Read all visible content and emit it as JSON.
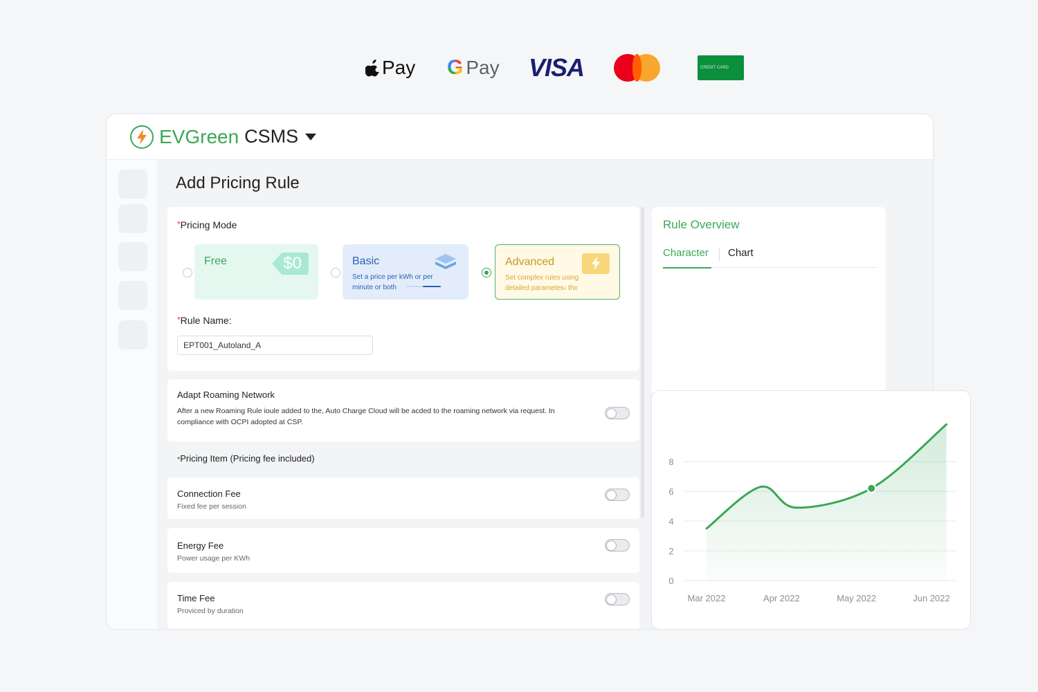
{
  "payment_methods": {
    "apple_pay": "Pay",
    "google_pay": "Pay",
    "visa": "VISA",
    "mastercard_icon": "mastercard-logo",
    "green_card_text": "CREDIT CARD"
  },
  "header": {
    "brand_name": "EVGreen",
    "brand_suffix": "CSMS",
    "brand_color": "#3aa757"
  },
  "page": {
    "title": "Add Pricing Rule"
  },
  "pricing_mode": {
    "label": "Pricing Mode",
    "selected": "Advanced",
    "options": [
      {
        "title": "Free",
        "tag": "$0"
      },
      {
        "title": "Basic",
        "desc": "Set a price per kWh or per minute or both"
      },
      {
        "title": "Advanced",
        "desc": "Set complex rules using detailed parametes› thx"
      }
    ]
  },
  "rule_name": {
    "label": "Rule Name:",
    "value": "EPT001_Autoland_A"
  },
  "roaming": {
    "title": "Adapt Roaming Network",
    "desc_line1": "After a new Roaming Rule ioule added to the, Auto Charge Cloud will be acded to the roaming network via request. In",
    "desc_line2": "compliance with OCPI adopted at CSP.",
    "enabled": false
  },
  "pricing_items": {
    "label": "Pricing Item",
    "label_note": "(Pricing fee included)",
    "items": [
      {
        "title": "Connection Fee",
        "sub": "Fixed fee per session",
        "enabled": false
      },
      {
        "title": "Energy Fee",
        "sub": "Power usage per KWh",
        "enabled": false
      },
      {
        "title": "Time Fee",
        "sub": "Proviced by duration",
        "enabled": false
      }
    ]
  },
  "overview": {
    "title": "Rule Overview",
    "tabs": [
      "Character",
      "Chart"
    ],
    "active_tab": "Character"
  },
  "chart_data": {
    "type": "area",
    "x": [
      "Mar 2022",
      "Apr 2022",
      "May 2022",
      "Jun 2022"
    ],
    "y_ticks": [
      0,
      2,
      4,
      6,
      8
    ],
    "ylim": [
      0,
      8
    ],
    "grid": true,
    "line_color": "#3aa757",
    "points": [
      {
        "x": 0,
        "y": 3.5
      },
      {
        "x": 0.72,
        "y": 6.3
      },
      {
        "x": 1.2,
        "y": 4.9
      },
      {
        "x": 2.2,
        "y": 6.2
      },
      {
        "x": 3.2,
        "y": 10.5
      }
    ],
    "highlight_point": {
      "x": 2.2,
      "y": 6.2
    }
  }
}
